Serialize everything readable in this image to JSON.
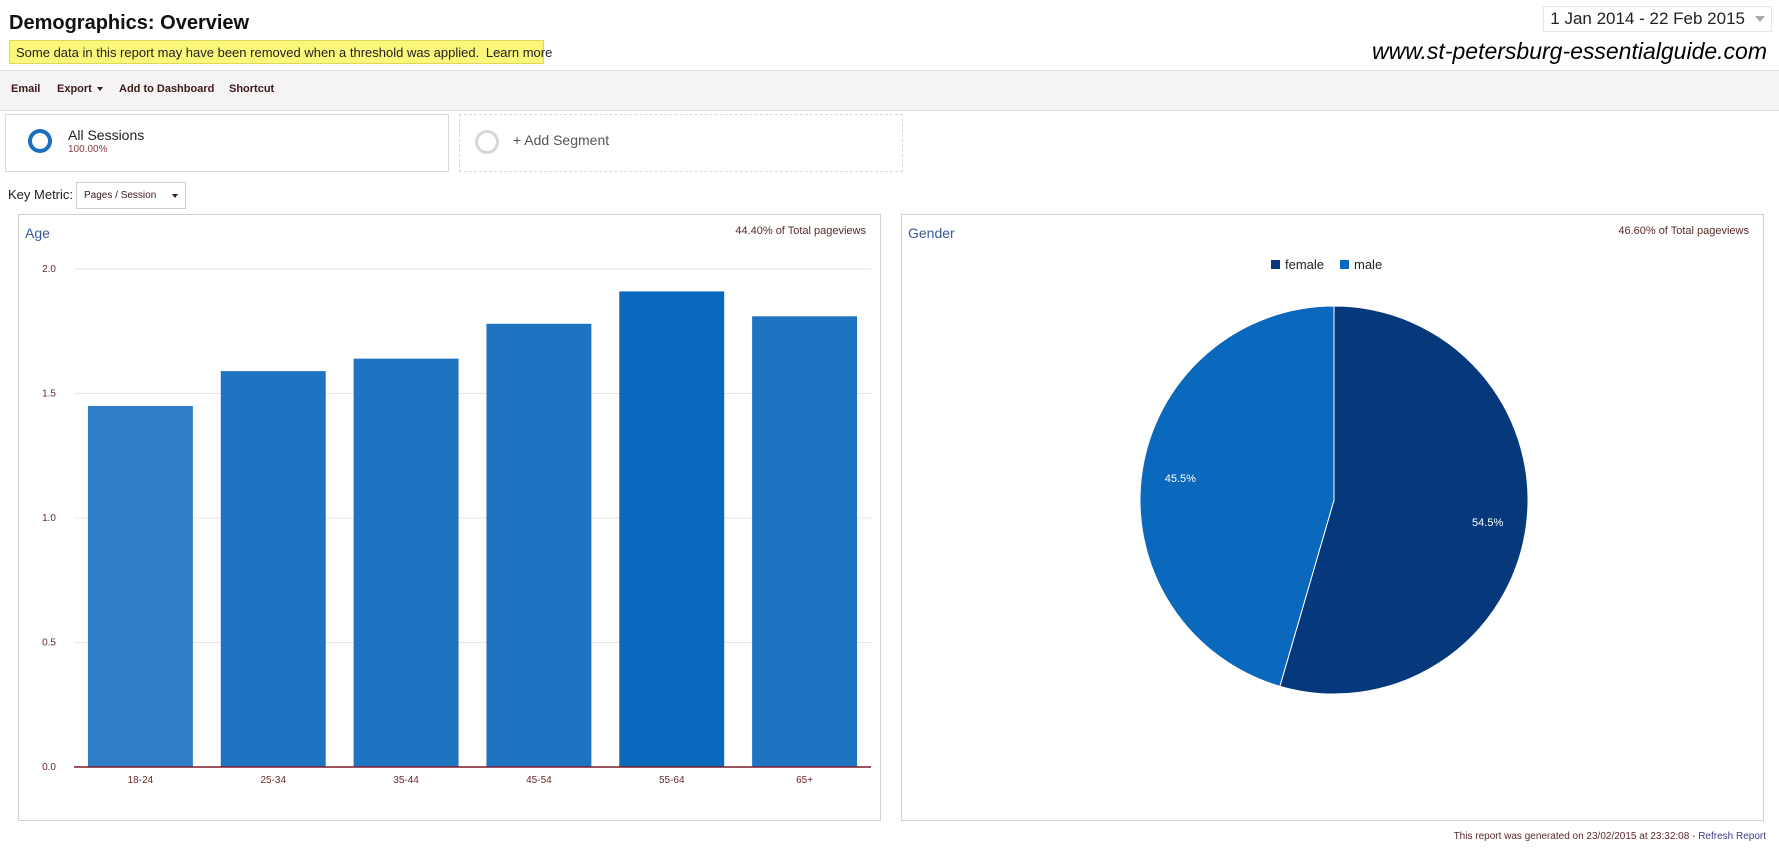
{
  "header": {
    "title": "Demographics: Overview",
    "notice_text": "Some data in this report may have been removed when a threshold was applied.",
    "notice_link": "Learn more",
    "date_range": "1 Jan 2014 - 22 Feb 2015",
    "watermark": "www.st-petersburg-essentialguide.com"
  },
  "toolbar": {
    "email": "Email",
    "export": "Export",
    "add_to_dashboard": "Add to Dashboard",
    "shortcut": "Shortcut"
  },
  "segments": {
    "all_sessions": {
      "name": "All Sessions",
      "pct": "100.00%"
    },
    "add_segment": "+ Add Segment"
  },
  "key_metric": {
    "label": "Key Metric:",
    "selected": "Pages / Session"
  },
  "age_panel": {
    "title": "Age",
    "pct": "44.40% of Total pageviews"
  },
  "gender_panel": {
    "title": "Gender",
    "pct": "46.60% of Total pageviews"
  },
  "footer": {
    "text": "This report was generated on 23/02/2015 at 23:32:08 - ",
    "refresh": "Refresh Report"
  },
  "colors": {
    "bar_light": "#2e7fc7",
    "bar_dark": "#0a68bd",
    "female": "#05397c",
    "male": "#0a68bd",
    "axis": "#7b1d2c"
  },
  "chart_data": [
    {
      "type": "bar",
      "title": "Age",
      "categories": [
        "18-24",
        "25-34",
        "35-44",
        "45-54",
        "55-64",
        "65+"
      ],
      "values": [
        1.45,
        1.59,
        1.64,
        1.78,
        1.91,
        1.81
      ],
      "ylim": [
        0,
        2.0
      ],
      "yticks": [
        "0.0",
        "0.5",
        "1.0",
        "1.5",
        "2.0"
      ],
      "grid": true
    },
    {
      "type": "pie",
      "title": "Gender",
      "labels": [
        "female",
        "male"
      ],
      "values": [
        54.5,
        45.5
      ],
      "value_labels": [
        "54.5%",
        "45.5%"
      ],
      "legend": "top"
    }
  ]
}
